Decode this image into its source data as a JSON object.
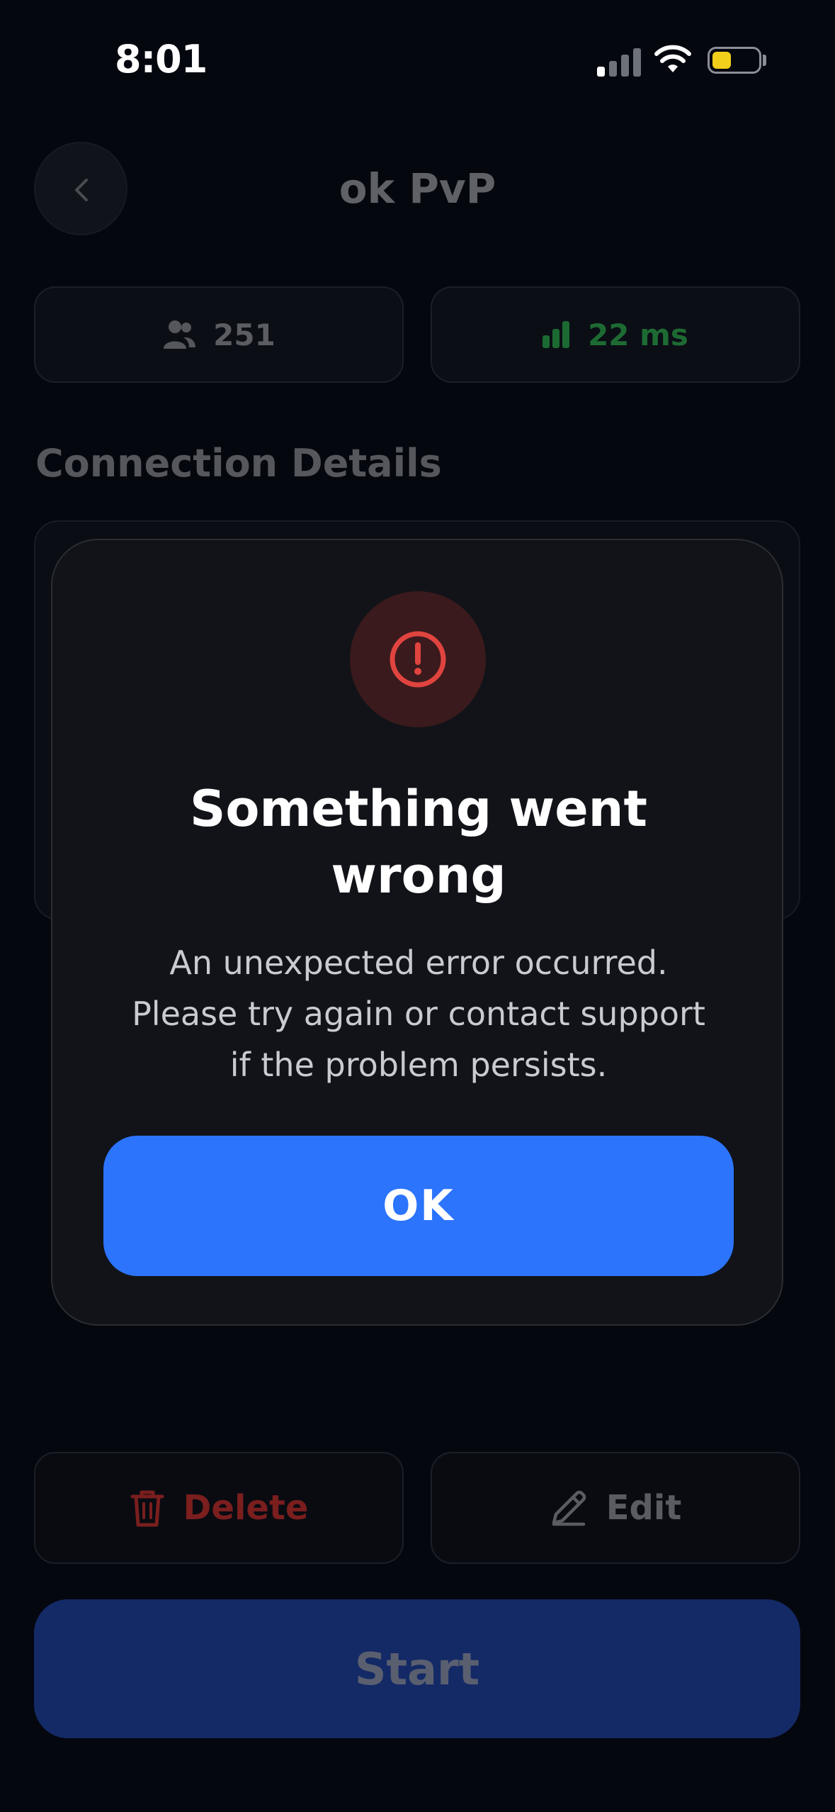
{
  "status_bar": {
    "time": "8:01"
  },
  "header": {
    "title": "ok PvP"
  },
  "stats": {
    "players": "251",
    "ping": "22 ms"
  },
  "connection": {
    "section_title": "Connection Details"
  },
  "actions": {
    "delete_label": "Delete",
    "edit_label": "Edit",
    "start_label": "Start"
  },
  "dialog": {
    "title_line1": "Something went",
    "title_line2": "wrong",
    "message_line1": "An unexpected error occurred.",
    "message_line2": "Please try again or contact support",
    "message_line3": "if the problem persists.",
    "ok_label": "OK"
  },
  "colors": {
    "accent": "#2c74fc",
    "error": "#e0443f",
    "ping_good": "#1f8a3a",
    "delete": "#c62828",
    "battery": "#f2cf1a"
  },
  "icons": [
    "chevron-left-icon",
    "users-icon",
    "signal-bars-icon",
    "trash-icon",
    "pencil-icon",
    "exclamation-circle-icon",
    "wifi-icon",
    "battery-icon"
  ]
}
